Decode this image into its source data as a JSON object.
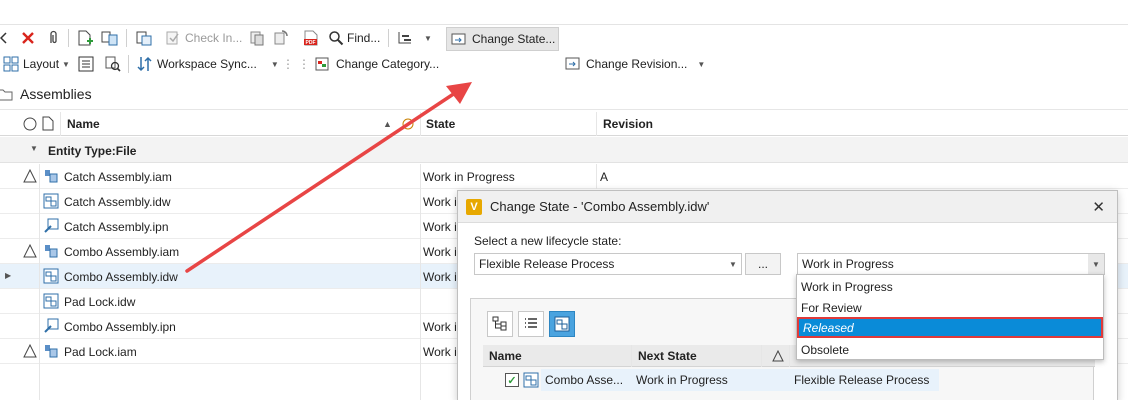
{
  "toolbar": {
    "check_in_label": "Check In...",
    "find_label": "Find...",
    "layout_label": "Layout",
    "workspace_sync_label": "Workspace Sync...",
    "change_category_label": "Change Category...",
    "change_state_label": "Change State...",
    "change_revision_label": "Change Revision..."
  },
  "folder": {
    "title": "Assemblies"
  },
  "grid": {
    "columns": {
      "name": "Name",
      "state": "State",
      "revision": "Revision"
    },
    "group_label": "Entity Type:File",
    "rows": [
      {
        "name": "Catch Assembly.iam",
        "state": "Work in Progress",
        "revision": "A"
      },
      {
        "name": "Catch Assembly.idw",
        "state": "Work in Progress",
        "revision": ""
      },
      {
        "name": "Catch Assembly.ipn",
        "state": "Work in Progress",
        "revision": ""
      },
      {
        "name": "Combo Assembly.iam",
        "state": "Work in Progress",
        "revision": ""
      },
      {
        "name": "Combo Assembly.idw",
        "state": "Work in Progress",
        "revision": ""
      },
      {
        "name": "Pad Lock.idw",
        "state": "",
        "revision": ""
      },
      {
        "name": "Combo Assembly.ipn",
        "state": "Work in Progress",
        "revision": ""
      },
      {
        "name": "Pad Lock.iam",
        "state": "Work in Progress",
        "revision": ""
      }
    ]
  },
  "dialog": {
    "title": "Change State - 'Combo Assembly.idw'",
    "app_icon_letter": "V",
    "prompt": "Select a new lifecycle state:",
    "lifecycle_definition": "Flexible Release Process",
    "browse_label": "...",
    "state_value": "Work in Progress",
    "options": [
      "Work in Progress",
      "For Review",
      "Released",
      "Obsolete"
    ],
    "table": {
      "columns": {
        "name": "Name",
        "next_state": "Next State"
      },
      "row": {
        "name": "Combo Asse...",
        "next_state": "Work in Progress",
        "definition": "Flexible Release Process"
      }
    }
  },
  "colors": {
    "accent": "#0a8bd8",
    "arrow": "#e84545",
    "highlight_border": "#e03a3a"
  }
}
